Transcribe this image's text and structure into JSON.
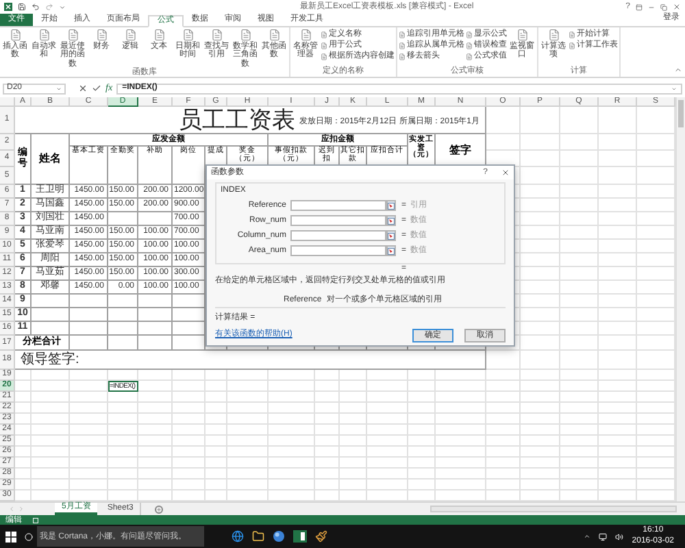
{
  "window": {
    "title": "最新员工Excel工资表模板.xls [兼容模式] - Excel",
    "help": "?"
  },
  "tabs": [
    {
      "label": "文件",
      "kind": "file",
      "selected": false
    },
    {
      "label": "开始",
      "kind": "tab",
      "selected": false
    },
    {
      "label": "插入",
      "kind": "tab",
      "selected": false
    },
    {
      "label": "页面布局",
      "kind": "tab",
      "selected": false
    },
    {
      "label": "公式",
      "kind": "tab",
      "selected": true
    },
    {
      "label": "数据",
      "kind": "tab",
      "selected": false
    },
    {
      "label": "审阅",
      "kind": "tab",
      "selected": false
    },
    {
      "label": "视图",
      "kind": "tab",
      "selected": false
    },
    {
      "label": "开发工具",
      "kind": "tab",
      "selected": false
    }
  ],
  "account": "登录",
  "ribbon": [
    {
      "name": "函数库",
      "items": [
        {
          "label": "插入函数",
          "kind": "large"
        },
        {
          "label": "自动求和",
          "kind": "large"
        },
        {
          "label": "最近使用的函数",
          "kind": "large"
        },
        {
          "label": "财务",
          "kind": "large"
        },
        {
          "label": "逻辑",
          "kind": "large"
        },
        {
          "label": "文本",
          "kind": "large"
        },
        {
          "label": "日期和时间",
          "kind": "large"
        },
        {
          "label": "查找与引用",
          "kind": "large"
        },
        {
          "label": "数学和三角函数",
          "kind": "large"
        },
        {
          "label": "其他函数",
          "kind": "large"
        }
      ]
    },
    {
      "name": "定义的名称",
      "items": [
        {
          "label": "名称管理器",
          "kind": "large"
        },
        {
          "label": "定义名称",
          "kind": "small"
        },
        {
          "label": "用于公式",
          "kind": "small"
        },
        {
          "label": "根据所选内容创建",
          "kind": "small"
        }
      ]
    },
    {
      "name": "公式审核",
      "items": [
        {
          "label": "追踪引用单元格",
          "kind": "small"
        },
        {
          "label": "追踪从属单元格",
          "kind": "small"
        },
        {
          "label": "移去箭头",
          "kind": "small"
        },
        {
          "label": "显示公式",
          "kind": "small"
        },
        {
          "label": "错误检查",
          "kind": "small"
        },
        {
          "label": "公式求值",
          "kind": "small"
        },
        {
          "label": "监视窗口",
          "kind": "large"
        }
      ]
    },
    {
      "name": "计算",
      "items": [
        {
          "label": "计算选项",
          "kind": "large"
        },
        {
          "label": "开始计算",
          "kind": "small"
        },
        {
          "label": "计算工作表",
          "kind": "small"
        }
      ]
    }
  ],
  "formula_bar": {
    "name_box": "D20",
    "fx": "fx",
    "formula": "=INDEX()"
  },
  "columns": [
    {
      "label": "A",
      "selected": false
    },
    {
      "label": "B",
      "selected": false
    },
    {
      "label": "C",
      "selected": false
    },
    {
      "label": "D",
      "selected": true
    },
    {
      "label": "E",
      "selected": false
    },
    {
      "label": "F",
      "selected": false
    },
    {
      "label": "G",
      "selected": false
    },
    {
      "label": "H",
      "selected": false
    },
    {
      "label": "I",
      "selected": false
    },
    {
      "label": "J",
      "selected": false
    },
    {
      "label": "K",
      "selected": false
    },
    {
      "label": "L",
      "selected": false
    },
    {
      "label": "M",
      "selected": false
    },
    {
      "label": "N",
      "selected": false
    },
    {
      "label": "O",
      "selected": false
    },
    {
      "label": "P",
      "selected": false
    },
    {
      "label": "Q",
      "selected": false
    },
    {
      "label": "R",
      "selected": false
    },
    {
      "label": "S",
      "selected": false
    }
  ],
  "title_row": {
    "num": "1",
    "selected": false,
    "title": "员工工资表",
    "date_line": "发放日期：2015年2月12日 所属日期：2015年1月"
  },
  "header": {
    "row_numbers": [
      {
        "num": "2",
        "selected": false
      },
      {
        "num": "4",
        "selected": false
      },
      {
        "num": "5",
        "selected": false
      }
    ],
    "id": "编号",
    "name": "姓名",
    "pay_group": "应发金额",
    "pay_items": [
      "基本工资",
      "全勤奖",
      "补助",
      "岗位",
      "提成",
      "奖金（元）"
    ],
    "deduct_group": "应扣金额",
    "deduct_items": [
      "事假扣款（元）",
      "迟到扣",
      "其它扣款",
      "应扣合计"
    ],
    "net": "实发工资（元）",
    "sign": "签字"
  },
  "rows": [
    {
      "num": "6",
      "selected": false,
      "cells": [
        "1",
        "王卫明",
        "1450.00",
        "150.00",
        "200.00",
        "1200.00"
      ]
    },
    {
      "num": "7",
      "selected": false,
      "cells": [
        "2",
        "马国鑫",
        "1450.00",
        "150.00",
        "200.00",
        "900.00"
      ]
    },
    {
      "num": "8",
      "selected": false,
      "cells": [
        "3",
        "刘国壮",
        "1450.00",
        null,
        null,
        "700.00"
      ]
    },
    {
      "num": "9",
      "selected": false,
      "cells": [
        "4",
        "马亚南",
        "1450.00",
        "150.00",
        "100.00",
        "700.00"
      ]
    },
    {
      "num": "10",
      "selected": false,
      "cells": [
        "5",
        "张爱琴",
        "1450.00",
        "150.00",
        "100.00",
        "100.00"
      ]
    },
    {
      "num": "11",
      "selected": false,
      "cells": [
        "6",
        "周阳",
        "1450.00",
        "150.00",
        "100.00",
        "100.00"
      ]
    },
    {
      "num": "12",
      "selected": false,
      "cells": [
        "7",
        "马亚茹",
        "1450.00",
        "150.00",
        "100.00",
        "300.00"
      ]
    },
    {
      "num": "13",
      "selected": false,
      "cells": [
        "8",
        "邓馨",
        "1450.00",
        "0.00",
        "100.00",
        "100.00"
      ]
    },
    {
      "num": "14",
      "selected": false,
      "cells": [
        "9"
      ]
    },
    {
      "num": "15",
      "selected": false,
      "cells": [
        "10"
      ]
    },
    {
      "num": "16",
      "selected": false,
      "cells": [
        "11"
      ]
    }
  ],
  "total_row": {
    "num": "17",
    "selected": false,
    "label": "分栏合计"
  },
  "sign_row": {
    "num": "18",
    "selected": false,
    "label": "领导签字:"
  },
  "blank_rows": [
    {
      "num": "19",
      "selected": false
    },
    {
      "num": "20",
      "selected": true,
      "active_cell": "=INDEX()"
    },
    {
      "num": "21",
      "selected": false
    },
    {
      "num": "22",
      "selected": false
    },
    {
      "num": "23",
      "selected": false
    },
    {
      "num": "24",
      "selected": false
    },
    {
      "num": "25",
      "selected": false
    },
    {
      "num": "26",
      "selected": false
    },
    {
      "num": "27",
      "selected": false
    },
    {
      "num": "28",
      "selected": false
    },
    {
      "num": "29",
      "selected": false
    },
    {
      "num": "30",
      "selected": false
    }
  ],
  "dialog": {
    "title": "函数参数",
    "help": "?",
    "function": "INDEX",
    "args": [
      {
        "label": "Reference",
        "hint": "引用"
      },
      {
        "label": "Row_num",
        "hint": "数值"
      },
      {
        "label": "Column_num",
        "hint": "数值"
      },
      {
        "label": "Area_num",
        "hint": "数值"
      }
    ],
    "equals": "=",
    "description": "在给定的单元格区域中，返回特定行列交叉处单元格的值或引用",
    "param_name": "Reference",
    "param_desc": "对一个或多个单元格区域的引用",
    "result": "计算结果 =",
    "help_link": "有关该函数的帮助(H)",
    "buttons": [
      {
        "label": "确定",
        "default": true
      },
      {
        "label": "取消",
        "default": false
      }
    ]
  },
  "sheet_tabs": [
    {
      "label": "5月工资",
      "selected": true
    },
    {
      "label": "Sheet3",
      "selected": false
    }
  ],
  "status": {
    "mode": "编辑"
  },
  "taskbar": {
    "placeholder": "我是 Cortana，小娜。有问题尽管问我。",
    "time": "16:10",
    "date": "2016-03-02"
  }
}
